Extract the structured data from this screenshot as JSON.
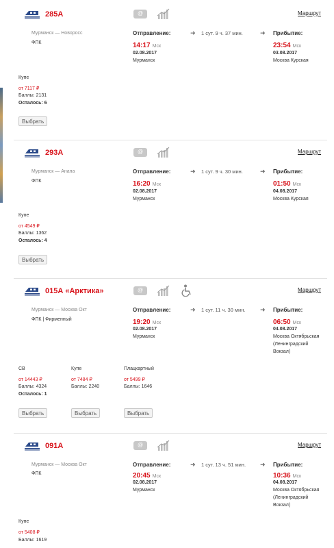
{
  "route_link": "Маршрут",
  "departure_label": "Отправление:",
  "arrival_label": "Прибытие:",
  "tz": "Мск",
  "select_label": "Выбрать",
  "trains": [
    {
      "number": "285А",
      "route": "Мурманск — Новоросс",
      "carrier": "ФПК",
      "duration": "1 сут. 9 ч. 37 мин.",
      "dep_time": "14:17",
      "dep_date": "02.08.2017",
      "dep_city": "Мурманск",
      "arr_time": "23:54",
      "arr_date": "03.08.2017",
      "arr_city": "Москва Курская",
      "classes": [
        {
          "name": "Купе",
          "price": "от 7117 ₽",
          "points": "Баллы: 2131",
          "left": "Осталось: 6"
        }
      ]
    },
    {
      "number": "293А",
      "route": "Мурманск — Анапа",
      "carrier": "ФПК",
      "duration": "1 сут. 9 ч. 30 мин.",
      "dep_time": "16:20",
      "dep_date": "02.08.2017",
      "dep_city": "Мурманск",
      "arr_time": "01:50",
      "arr_date": "04.08.2017",
      "arr_city": "Москва Курская",
      "classes": [
        {
          "name": "Купе",
          "price": "от 4549 ₽",
          "points": "Баллы: 1362",
          "left": "Осталось: 4"
        }
      ]
    },
    {
      "number": "015А «Арктика»",
      "route": "Мурманск — Москва Окт",
      "carrier": "ФПК | Фирменный",
      "duration": "1 сут. 11 ч. 30 мин.",
      "dep_time": "19:20",
      "dep_date": "02.08.2017",
      "dep_city": "Мурманск",
      "arr_time": "06:50",
      "arr_date": "04.08.2017",
      "arr_city_lines": [
        "Москва Октябрьская",
        "(Ленинградский",
        "Вокзал)"
      ],
      "classes": [
        {
          "name": "СВ",
          "price": "от 14443 ₽",
          "points": "Баллы: 4324",
          "left": "Осталось: 1"
        },
        {
          "name": "Купе",
          "price": "от 7484 ₽",
          "points": "Баллы: 2240"
        },
        {
          "name": "Плацкартный",
          "price": "от 5499 ₽",
          "points": "Баллы: 1646"
        }
      ]
    },
    {
      "number": "091А",
      "route": "Мурманск — Москва Окт",
      "carrier": "ФПК",
      "duration": "1 сут. 13 ч. 51 мин.",
      "dep_time": "20:45",
      "dep_date": "02.08.2017",
      "dep_city": "Мурманск",
      "arr_time": "10:36",
      "arr_date": "04.08.2017",
      "arr_city_lines": [
        "Москва Октябрьская",
        "(Ленинградский",
        "Вокзал)"
      ],
      "classes": [
        {
          "name": "Купе",
          "price": "от 5408 ₽",
          "points": "Баллы: 1619"
        }
      ]
    }
  ]
}
